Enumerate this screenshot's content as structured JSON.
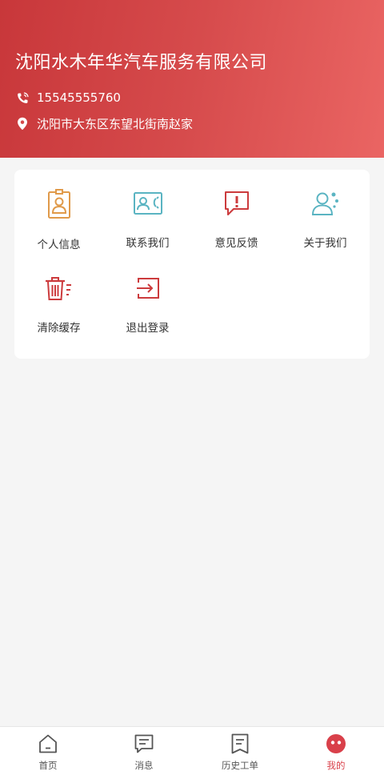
{
  "header": {
    "company_name": "沈阳水木年华汽车服务有限公司",
    "phone": "15545555760",
    "address": "沈阳市大东区东望北街南赵家",
    "phone_icon": "phone-icon",
    "address_icon": "location-pin-icon",
    "gradient_colors": [
      "#c8373a",
      "#ea6563"
    ]
  },
  "menu": {
    "items": [
      {
        "label": "个人信息",
        "icon": "id-badge-icon",
        "color": "#e09a4a"
      },
      {
        "label": "联系我们",
        "icon": "contact-card-icon",
        "color": "#5ab4c2"
      },
      {
        "label": "意见反馈",
        "icon": "feedback-icon",
        "color": "#cc3b3d"
      },
      {
        "label": "关于我们",
        "icon": "about-us-icon",
        "color": "#5ab4c2"
      },
      {
        "label": "清除缓存",
        "icon": "trash-icon",
        "color": "#cc3b3d"
      },
      {
        "label": "退出登录",
        "icon": "logout-icon",
        "color": "#cc3b3d"
      }
    ]
  },
  "tabbar": {
    "tabs": [
      {
        "label": "首页",
        "icon": "home-icon"
      },
      {
        "label": "消息",
        "icon": "message-icon"
      },
      {
        "label": "历史工单",
        "icon": "work-order-icon"
      },
      {
        "label": "我的",
        "icon": "profile-icon",
        "active": true
      }
    ],
    "active_color": "#d9404a"
  }
}
